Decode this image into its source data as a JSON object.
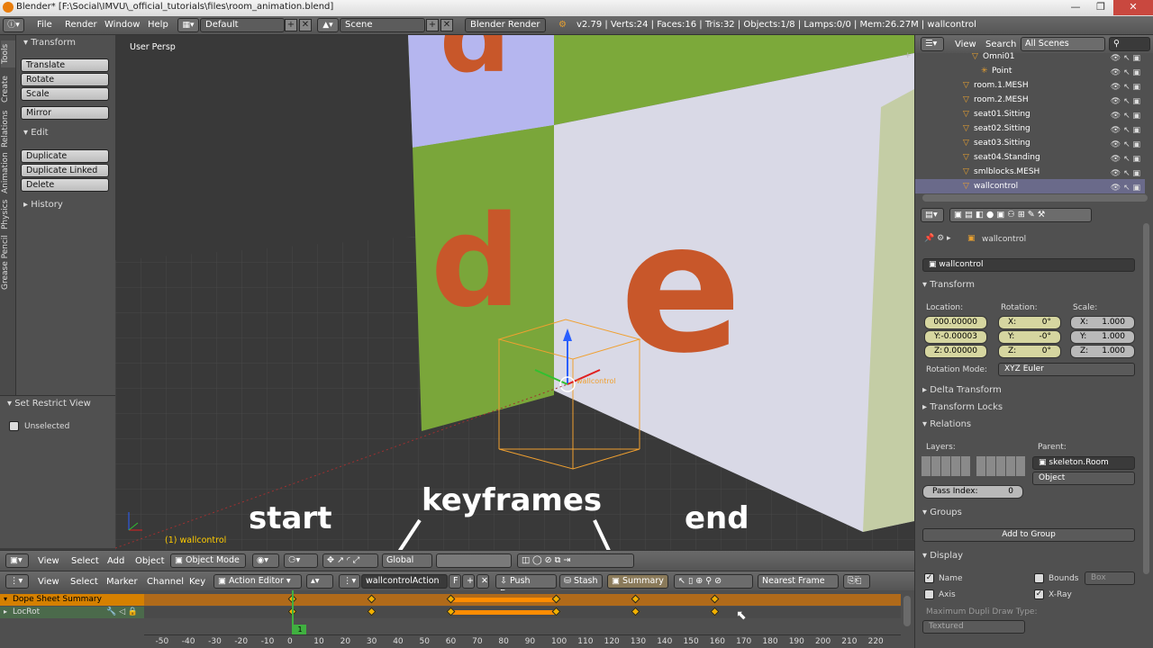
{
  "window": {
    "title": "Blender* [F:\\Social\\IMVU\\_official_tutorials\\files\\room_animation.blend]",
    "minimize": "—",
    "maximize": "❐",
    "close": "✕"
  },
  "topbar": {
    "menus": [
      "File",
      "Render",
      "Window",
      "Help"
    ],
    "layout": "Default",
    "scene": "Scene",
    "engine": "Blender Render",
    "stats": "v2.79 | Verts:24 | Faces:16 | Tris:32 | Objects:1/8 | Lamps:0/0 | Mem:26.27M | wallcontrol"
  },
  "tabs": [
    "Tools",
    "Create",
    "Relations",
    "Animation",
    "Physics",
    "Grease Pencil"
  ],
  "tools": {
    "transform_title": "Transform",
    "transform_buttons": [
      "Translate",
      "Rotate",
      "Scale"
    ],
    "mirror": "Mirror",
    "edit_title": "Edit",
    "edit_buttons": [
      "Duplicate",
      "Duplicate Linked",
      "Delete"
    ],
    "history": "History"
  },
  "restrict": {
    "title": "Set Restrict View",
    "unselected": "Unselected"
  },
  "viewport": {
    "label": "User Persp",
    "object_label": "(1) wallcontrol",
    "empty_label": "wallcontrol",
    "letters": [
      "d",
      "d",
      "e"
    ]
  },
  "overlays": {
    "start": "start",
    "keyframes": "keyframes",
    "end": "end"
  },
  "vpheader": {
    "menus": [
      "View",
      "Select",
      "Add",
      "Object"
    ],
    "mode": "Object Mode",
    "orientation": "Global"
  },
  "dsheader": {
    "menus": [
      "View",
      "Select",
      "Marker",
      "Channel",
      "Key"
    ],
    "editor": "Action Editor",
    "action": "wallcontrolAction",
    "f_btn": "F",
    "push_down": "Push Down",
    "stash": "Stash",
    "summary": "Summary",
    "snap": "Nearest Frame"
  },
  "dope": {
    "channels": [
      "Dope Sheet Summary",
      "LocRot"
    ],
    "keyframes": [
      0,
      30,
      60,
      100,
      130,
      160
    ],
    "hold": [
      60,
      100
    ],
    "current_frame": "1",
    "ruler": [
      "-50",
      "-40",
      "-30",
      "-20",
      "-10",
      "0",
      "10",
      "20",
      "30",
      "40",
      "50",
      "60",
      "70",
      "80",
      "90",
      "100",
      "110",
      "120",
      "130",
      "140",
      "150",
      "160",
      "170",
      "180",
      "190",
      "200",
      "210",
      "220"
    ],
    "colors": {
      "summary": "#d58000",
      "key": "#f2b000",
      "hold": "#ff8c00"
    }
  },
  "outliner": {
    "menus": [
      "View",
      "Search"
    ],
    "filter": "All Scenes",
    "rows": [
      "Omni01",
      "Point",
      "room.1.MESH",
      "room.2.MESH",
      "seat01.Sitting",
      "seat02.Sitting",
      "seat03.Sitting",
      "seat04.Standing",
      "smlblocks.MESH",
      "wallcontrol"
    ]
  },
  "props": {
    "object": "wallcontrol",
    "name": "wallcontrol",
    "transform": "Transform",
    "location_label": "Location:",
    "rotation_label": "Rotation:",
    "scale_label": "Scale:",
    "location": [
      "000.00000",
      "-0.00003",
      "0.00000"
    ],
    "loc_axes": [
      "",
      "Y:",
      "Z:"
    ],
    "rotation": [
      "0°",
      "-0°",
      "0°"
    ],
    "rot_axes": [
      "X:",
      "Y:",
      "Z:"
    ],
    "scale": [
      "1.000",
      "1.000",
      "1.000"
    ],
    "scale_axes": [
      "X:",
      "Y:",
      "Z:"
    ],
    "rotation_mode_label": "Rotation Mode:",
    "rotation_mode": "XYZ Euler",
    "delta": "Delta Transform",
    "locks": "Transform Locks",
    "relations": "Relations",
    "layers_label": "Layers:",
    "parent_label": "Parent:",
    "parent": "skeleton.Room",
    "parent_type": "Object",
    "pass_index_label": "Pass Index:",
    "pass_index": "0",
    "groups": "Groups",
    "add_group": "Add to Group",
    "display": "Display",
    "name_chk": "Name",
    "bounds_chk": "Bounds",
    "bounds_type": "Box",
    "axis_chk": "Axis",
    "xray_chk": "X-Ray",
    "max_draw": "Maximum Dupli Draw Type:",
    "draw_type": "Textured"
  }
}
